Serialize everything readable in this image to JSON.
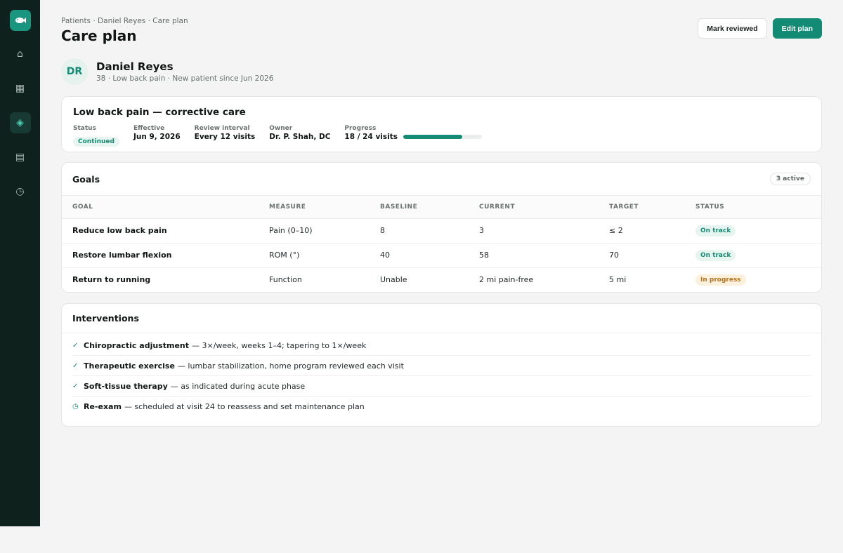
{
  "sidebar": {
    "logo_icon": "fish-logo-icon",
    "items": [
      {
        "name": "home",
        "icon": "home-icon",
        "glyph": "⌂",
        "active": false
      },
      {
        "name": "calendar",
        "icon": "calendar-icon",
        "glyph": "▦",
        "active": false
      },
      {
        "name": "care-plans",
        "icon": "layers-icon",
        "glyph": "◈",
        "active": true
      },
      {
        "name": "notes",
        "icon": "document-icon",
        "glyph": "▤",
        "active": false
      },
      {
        "name": "history",
        "icon": "clock-icon",
        "glyph": "◷",
        "active": false
      }
    ]
  },
  "header": {
    "breadcrumb": "Patients · Daniel Reyes · Care plan",
    "title": "Care plan",
    "mark_reviewed_label": "Mark reviewed",
    "edit_plan_label": "Edit plan"
  },
  "patient": {
    "initials": "DR",
    "name": "Daniel Reyes",
    "meta": "38 · Low back pain · New patient since Jun 2026"
  },
  "plan": {
    "title": "Low back pain — corrective care",
    "status_label": "Status",
    "status_value": "Continued",
    "effective_label": "Effective",
    "effective_value": "Jun 9, 2026",
    "review_label": "Review interval",
    "review_value": "Every 12 visits",
    "owner_label": "Owner",
    "owner_value": "Dr. P. Shah, DC",
    "progress_label": "Progress",
    "progress_value": "18 / 24 visits",
    "progress_fraction": 0.75
  },
  "goals": {
    "title": "Goals",
    "count_badge": "3 active",
    "columns": [
      "GOAL",
      "MEASURE",
      "BASELINE",
      "CURRENT",
      "TARGET",
      "STATUS"
    ],
    "rows": [
      {
        "goal": "Reduce low back pain",
        "measure": "Pain (0–10)",
        "baseline": "8",
        "current": "3",
        "target": "≤ 2",
        "status": "On track",
        "status_kind": "ok"
      },
      {
        "goal": "Restore lumbar flexion",
        "measure": "ROM (°)",
        "baseline": "40",
        "current": "58",
        "target": "70",
        "status": "On track",
        "status_kind": "ok"
      },
      {
        "goal": "Return to running",
        "measure": "Function",
        "baseline": "Unable",
        "current": "2 mi pain-free",
        "target": "5 mi",
        "status": "In progress",
        "status_kind": "prog"
      }
    ]
  },
  "interventions": {
    "title": "Interventions",
    "items": [
      {
        "icon": "check-icon",
        "glyph": "✓",
        "name": "Chiropractic adjustment",
        "detail": "— 3×/week, weeks 1–4; tapering to 1×/week"
      },
      {
        "icon": "check-icon",
        "glyph": "✓",
        "name": "Therapeutic exercise",
        "detail": "— lumbar stabilization, home program reviewed each visit"
      },
      {
        "icon": "check-icon",
        "glyph": "✓",
        "name": "Soft-tissue therapy",
        "detail": "— as indicated during acute phase"
      },
      {
        "icon": "clock-icon",
        "glyph": "◷",
        "name": "Re-exam",
        "detail": "— scheduled at visit 24 to reassess and set maintenance plan"
      }
    ]
  },
  "colors": {
    "accent": "#128a74",
    "sidebar_bg": "#0f211d",
    "on_track_bg": "#e6f5f0",
    "in_progress_bg": "#fdf1de",
    "in_progress_text": "#b8731a"
  }
}
